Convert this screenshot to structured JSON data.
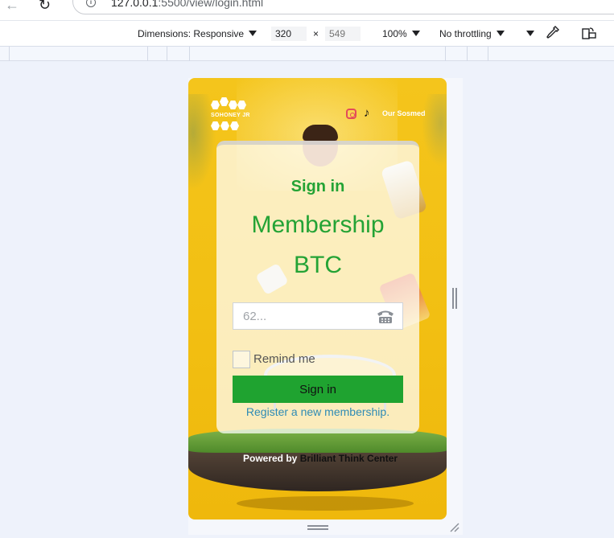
{
  "browser": {
    "url_host": "127.0.0.1",
    "url_rest": ":5500/view/login.html"
  },
  "device_toolbar": {
    "dimensions_label": "Dimensions: Responsive",
    "width": "320",
    "height_placeholder": "549",
    "times": "×",
    "zoom": "100%",
    "throttling": "No throttling"
  },
  "page": {
    "logo_text": "SOHONEY JR",
    "sosmed_label": "Our Sosmed",
    "card": {
      "heading": "Sign in",
      "title_line1": "Membership",
      "title_line2": "BTC",
      "phone_placeholder": "62...",
      "remember_label": "Remind me",
      "signin_button": "Sign in",
      "register_link": "Register a new membership."
    },
    "powered_by": "Powered by",
    "brand": "Brilliant Think Center"
  },
  "colors": {
    "background_yellow": "#f4c51c",
    "accent_green": "#24a335",
    "button_green": "#1fa330",
    "link_blue": "#2e8bb5"
  },
  "icons": [
    "back-arrow-icon",
    "reload-icon",
    "info-icon",
    "instagram-icon",
    "tiktok-icon",
    "phone-icon",
    "eyedropper-icon",
    "rotate-icon"
  ]
}
